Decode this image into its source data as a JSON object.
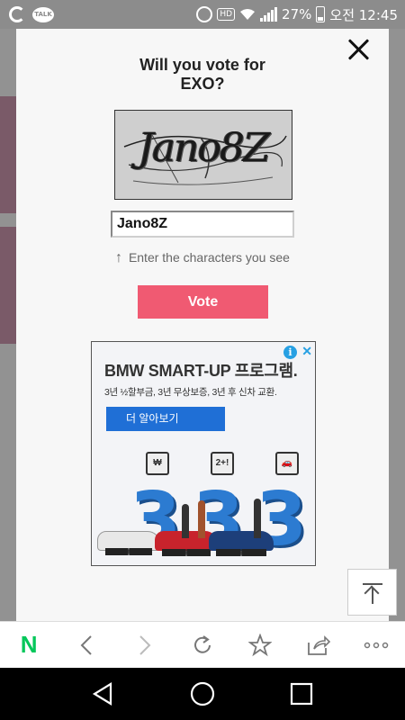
{
  "status_bar": {
    "talk_label": "TALK",
    "hd_label": "HD",
    "battery": "27%",
    "time": "오전 12:45"
  },
  "modal": {
    "title_line1": "Will you vote for",
    "title_line2": "EXO?",
    "captcha_text": "Jano8Z",
    "input_value": "Jano8Z",
    "hint_arrow": "↑",
    "hint_text": "Enter the characters you see",
    "vote_label": "Vote"
  },
  "ad": {
    "info_label": "i",
    "close_label": "✕",
    "title": "BMW SMART-UP 프로그램.",
    "subtitle": "3년 ½할부금, 3년 무상보증, 3년 후 신차 교환.",
    "cta": "더 알아보기",
    "icon_labels": [
      "₩",
      "2+!",
      "🚗"
    ],
    "digits": [
      "3",
      "3",
      "3"
    ]
  },
  "toolbar": {
    "home": "N"
  },
  "colors": {
    "vote": "#f05a72",
    "naver_green": "#03c75a",
    "ad_blue": "#1f6fd6",
    "ad_info": "#27a0e3"
  }
}
